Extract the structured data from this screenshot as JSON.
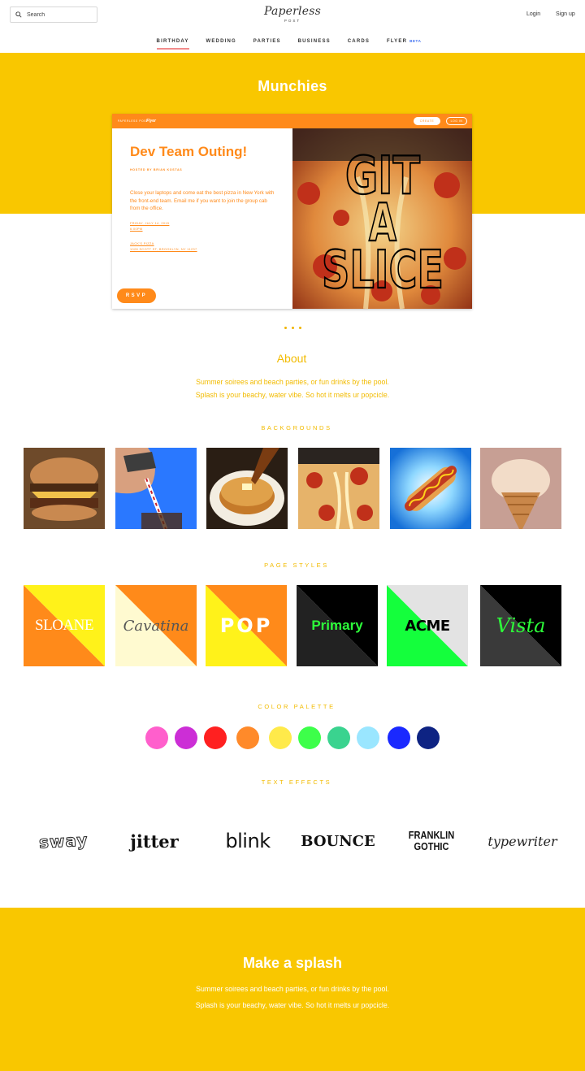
{
  "header": {
    "search_placeholder": "Search",
    "logo": "Paperless",
    "logo_sub": "POST",
    "login": "Login",
    "signup": "Sign up",
    "nav": [
      {
        "label": "BIRTHDAY",
        "active": true
      },
      {
        "label": "WEDDING",
        "active": false
      },
      {
        "label": "PARTIES",
        "active": false
      },
      {
        "label": "BUSINESS",
        "active": false
      },
      {
        "label": "CARDS",
        "active": false
      },
      {
        "label": "FLYER",
        "active": false
      }
    ],
    "beta": "BETA"
  },
  "hero": {
    "title": "Munchies"
  },
  "card": {
    "brand": "PAPERLESS POST",
    "brand_flyer": "Flyer",
    "create": "CREATE",
    "login": "LOG IN",
    "title": "Dev Team Outing!",
    "host": "HOSTED BY BRIAN KOSTAS",
    "description": "Close your laptops and come eat the best pizza in New York with the front-end team. Email me if you want to join the group cab from the office.",
    "date_line1": "FRIDAY, JULY 14, 2015",
    "date_line2": "6:00PM",
    "place_line1": "JACK'S PIZZA",
    "place_line2": "1028 SCOTT ST, BROOKLYN, NY 11237",
    "rsvp": "RSVP",
    "art_text": [
      "GIT",
      "A",
      "SLICE"
    ]
  },
  "about": {
    "title": "About",
    "line1": "Summer soirees and beach parties, or fun drinks by the pool.",
    "line2": "Splash is your beachy, water vibe. So hot it melts ur popcicle."
  },
  "sections": {
    "backgrounds": "BACKGROUNDS",
    "page_styles": "PAGE STYLES",
    "color_palette": "COLOR PALETTE",
    "text_effects": "TEXT EFFECTS"
  },
  "backgrounds": [
    {
      "name": "burger",
      "colors": [
        "#6b3a1f",
        "#c26a33"
      ]
    },
    {
      "name": "soda",
      "colors": [
        "#1c5cf0",
        "#2b8cff"
      ]
    },
    {
      "name": "pancakes",
      "colors": [
        "#f1e7d6",
        "#b07a2f"
      ]
    },
    {
      "name": "pizza",
      "colors": [
        "#c8391b",
        "#f0b46a"
      ]
    },
    {
      "name": "hotdog",
      "colors": [
        "#1b86e6",
        "#9fe0ff"
      ]
    },
    {
      "name": "ice-cream",
      "colors": [
        "#b98f86",
        "#f1dccd"
      ]
    }
  ],
  "page_styles": [
    {
      "label": "SLOANE",
      "a": "#ff8a1a",
      "b": "#fff21a",
      "color": "#ffffff"
    },
    {
      "label": "Cavatina",
      "a": "#fffad0",
      "b": "#ff8a1a",
      "color": "#555555"
    },
    {
      "label": "POP",
      "a": "#fff21a",
      "b": "#ff8a1a",
      "color": "#ffffff"
    },
    {
      "label": "Primary",
      "a": "#222222",
      "b": "#000000",
      "color": "#2dff3a"
    },
    {
      "label": "ACME",
      "a": "#14ff3c",
      "b": "#e3e3e3",
      "color": "#000000"
    },
    {
      "label": "Vista",
      "a": "#3a3a3a",
      "b": "#000000",
      "color": "#2dff3a"
    }
  ],
  "palette": [
    "#ff5fcc",
    "#cc2ed6",
    "#ff2020",
    "#ff8a2a",
    "#ffea4a",
    "#3dff4a",
    "#3ad38f",
    "#9ae6ff",
    "#1a29ff",
    "#0e2383"
  ],
  "text_effects": [
    "sway",
    "jitter",
    "blink",
    "BOUNCE",
    "FRANKLIN GOTHIC",
    "typewriter"
  ],
  "footer": {
    "title": "Make a splash",
    "line1": "Summer soirees and beach parties, or fun drinks by the pool.",
    "line2": "Splash is your beachy, water vibe. So hot it melts ur popcicle."
  }
}
